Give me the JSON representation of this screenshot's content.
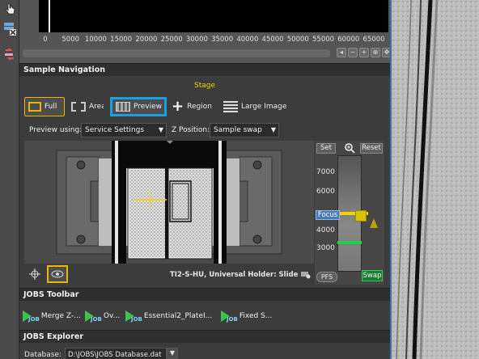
{
  "histogram": {
    "ticks": [
      "0",
      "5000",
      "10000",
      "15000",
      "20000",
      "25000",
      "30000",
      "35000",
      "40000",
      "45000",
      "50000",
      "55000",
      "60000",
      "65000"
    ],
    "controls": [
      "zoom-out-icon",
      "zoom-in-icon",
      "fit-icon",
      "expand-icon"
    ]
  },
  "sample_navigation": {
    "title": "Sample Navigation",
    "stage_label": "Stage",
    "modes": {
      "full": "Full",
      "area": "Area",
      "preview": "Preview",
      "region": "Region",
      "large_image": "Large Image"
    },
    "preview_using_label": "Preview using:",
    "preview_using_value": "Service Settings",
    "z_position_label": "Z Position:",
    "z_position_value": "Sample swap",
    "holder_label": "TI2-S-HU, Universal Holder: Slide"
  },
  "focus": {
    "set_label": "Set",
    "reset_label": "Reset",
    "scale": [
      "7000",
      "6000",
      "4000",
      "3000"
    ],
    "focus_label": "Focus",
    "pfs_label": "PFS",
    "swap_label": "Swap",
    "accent": "#f5d000",
    "green": "#22cc44"
  },
  "jobs_toolbar": {
    "title": "JOBS Toolbar",
    "tag": "JOB",
    "items": [
      "Merge Z-...",
      "Ov...",
      "Essential2_PlateI...",
      "Fixed S..."
    ]
  },
  "jobs_explorer": {
    "title": "JOBS Explorer",
    "database_label": "Database:",
    "database_value": "D:\\JOBS\\JOBS Database.dat"
  }
}
